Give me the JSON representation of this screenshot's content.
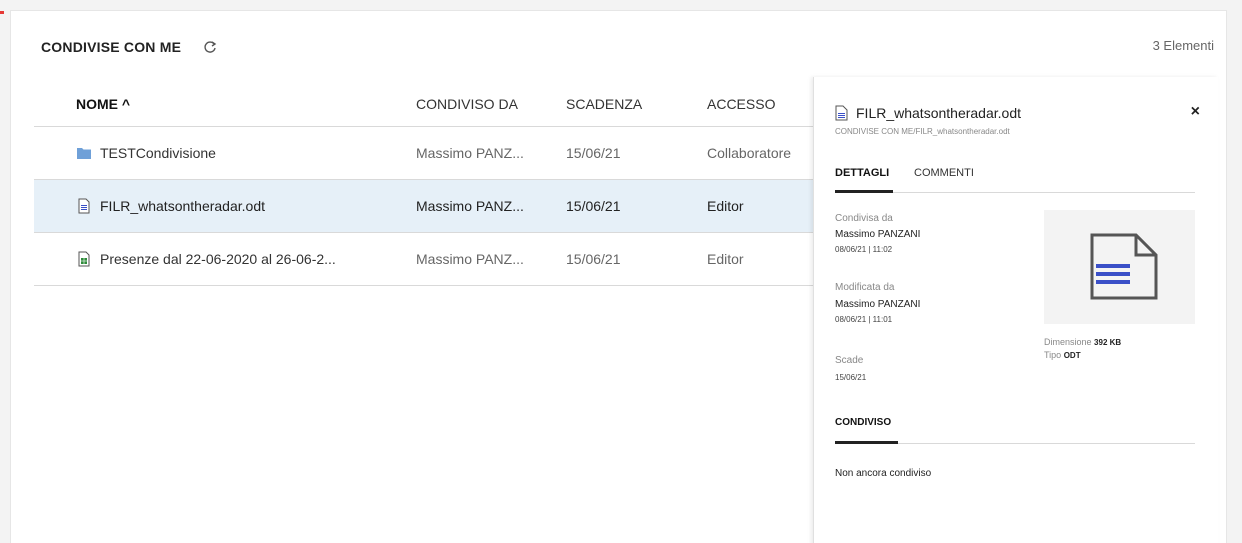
{
  "header": {
    "title": "CONDIVISE CON ME",
    "count": "3 Elementi"
  },
  "columns": {
    "name": "NOME ^",
    "shared_by": "CONDIVISO DA",
    "expires": "SCADENZA",
    "access": "ACCESSO"
  },
  "rows": [
    {
      "icon": "folder-icon",
      "name": "TESTCondivisione",
      "shared_by": "Massimo PANZ...",
      "expires": "15/06/21",
      "access": "Collaboratore",
      "selected": false
    },
    {
      "icon": "document-icon",
      "name": "FILR_whatsontheradar.odt",
      "shared_by": "Massimo PANZ...",
      "expires": "15/06/21",
      "access": "Editor",
      "selected": true
    },
    {
      "icon": "spreadsheet-icon",
      "name": "Presenze dal 22-06-2020 al 26-06-2...",
      "shared_by": "Massimo PANZ...",
      "expires": "15/06/21",
      "access": "Editor",
      "selected": false
    }
  ],
  "details": {
    "title": "FILR_whatsontheradar.odt",
    "close": "×",
    "path": "CONDIVISE CON ME/FILR_whatsontheradar.odt",
    "tabs": {
      "details": "DETTAGLI",
      "comments": "COMMENTI"
    },
    "shared_by_label": "Condivisa da",
    "shared_by_name": "Massimo PANZANI",
    "shared_by_date": "08/06/21 | 11:02",
    "modified_by_label": "Modificata da",
    "modified_by_name": "Massimo PANZANI",
    "modified_by_date": "08/06/21 | 11:01",
    "expires_label": "Scade",
    "expires_value": "15/06/21",
    "size_label": "Dimensione",
    "size_value": "392 KB",
    "type_label": "Tipo",
    "type_value": "ODT",
    "shared_heading": "CONDIVISO",
    "shared_none": "Non ancora condiviso"
  },
  "colors": {
    "accent": "#3a4fc7",
    "selected_row": "#e6f0f8",
    "folder": "#6fa0d8",
    "spreadsheet": "#2e8b3a"
  }
}
